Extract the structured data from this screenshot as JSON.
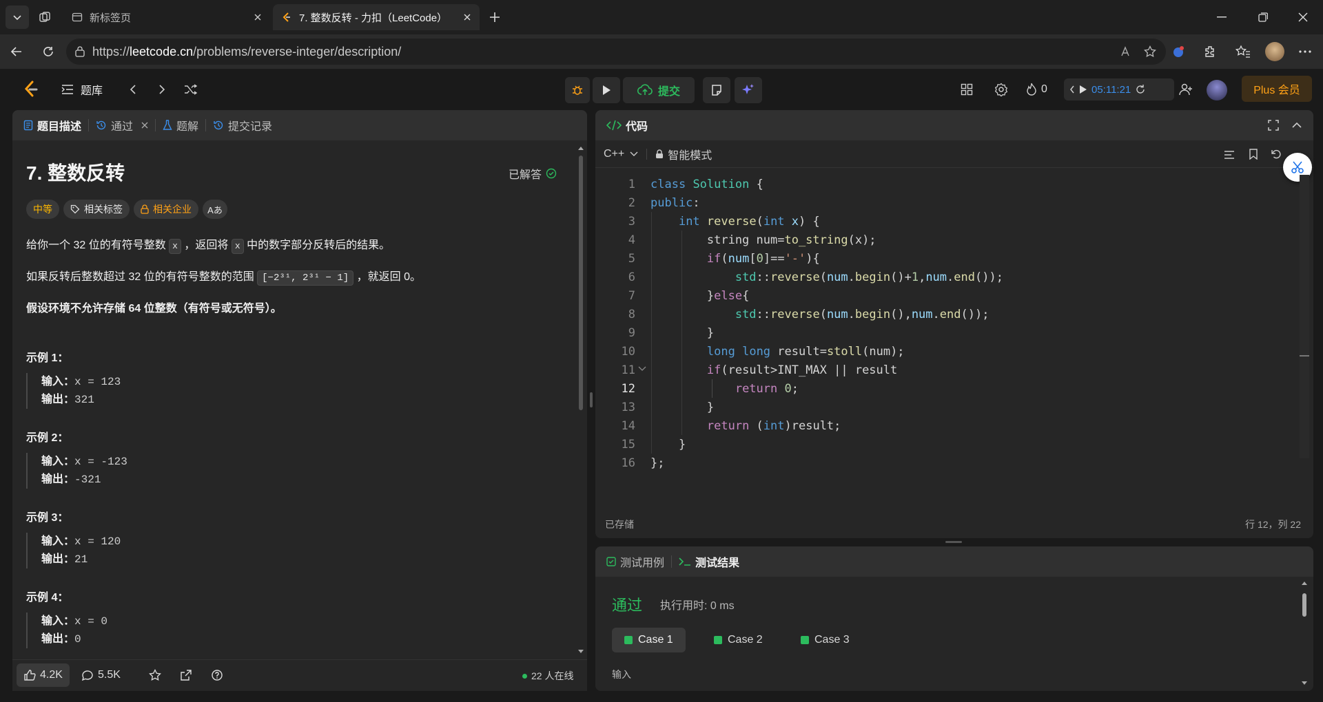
{
  "browser": {
    "tabs": [
      {
        "title": "新标签页"
      },
      {
        "title": "7. 整数反转 - 力扣（LeetCode）"
      }
    ],
    "url_prefix": "https://",
    "url_host": "leetcode.cn",
    "url_path": "/problems/reverse-integer/description/"
  },
  "nav": {
    "problem_list": "题库",
    "submit": "提交",
    "streak": "0",
    "timer": "05:11:21",
    "plus": "Plus 会员"
  },
  "left_panel": {
    "tabs": [
      "题目描述",
      "通过",
      "题解",
      "提交记录"
    ],
    "title": "7. 整数反转",
    "solved": "已解答",
    "tags": {
      "difficulty": "中等",
      "topics": "相关标签",
      "companies": "相关企业",
      "font": "Aあ"
    },
    "desc1_a": "给你一个 32 位的有符号整数 ",
    "desc1_code": "x",
    "desc1_b": " ，返回将 ",
    "desc1_c": " 中的数字部分反转后的结果。",
    "desc2_a": "如果反转后整数超过 32 位的有符号整数的范围 ",
    "desc2_range": "[−2³¹,  2³¹ − 1]",
    "desc2_b": " ，就返回 0。",
    "desc3": "假设环境不允许存储 64 位整数（有符号或无符号）。",
    "examples": [
      {
        "title": "示例 1：",
        "input": "x = 123",
        "output": "321"
      },
      {
        "title": "示例 2：",
        "input": "x = -123",
        "output": "-321"
      },
      {
        "title": "示例 3：",
        "input": "x = 120",
        "output": "21"
      },
      {
        "title": "示例 4：",
        "input": "x = 0",
        "output": "0"
      }
    ],
    "input_label": "输入：",
    "output_label": "输出：",
    "likes": "4.2K",
    "comments": "5.5K",
    "online": "22 人在线"
  },
  "code_panel": {
    "title": "代码",
    "language": "C++",
    "mode": "智能模式",
    "saved": "已存储",
    "cursor": "行 12，列 22",
    "lines": [
      "class Solution {",
      "public:",
      "    int reverse(int x) {",
      "        string num=to_string(x);",
      "        if(num[0]=='-'){",
      "            std::reverse(num.begin()+1,num.end());",
      "        }else{",
      "            std::reverse(num.begin(),num.end());",
      "        }",
      "        long long result=stoll(num);",
      "        if(result>INT_MAX || result<INT_MIN){",
      "            return 0;",
      "        }",
      "        return (int)result;",
      "    }",
      "};"
    ],
    "line_numbers": [
      "1",
      "2",
      "3",
      "4",
      "5",
      "6",
      "7",
      "8",
      "9",
      "10",
      "11",
      "12",
      "13",
      "14",
      "15",
      "16"
    ]
  },
  "result_panel": {
    "tab_cases": "测试用例",
    "tab_result": "测试结果",
    "status": "通过",
    "runtime": "执行用时: 0 ms",
    "cases": [
      "Case 1",
      "Case 2",
      "Case 3"
    ],
    "input_label": "输入"
  },
  "colors": {
    "accent_orange": "#ffa116",
    "pass_green": "#2cbb5d",
    "link_blue": "#3b8eea"
  }
}
